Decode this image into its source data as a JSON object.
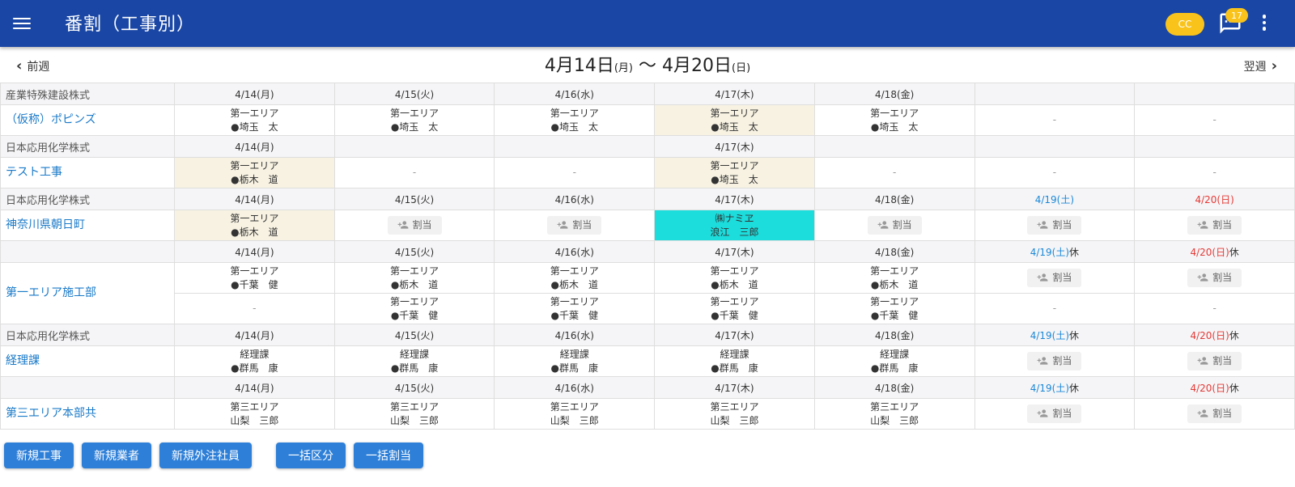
{
  "appbar": {
    "title": "番割（工事別）",
    "menu_icon": "menu-icon",
    "avatar_text": "CC",
    "chat_icon": "chat-icon",
    "notification_count": "17",
    "more_icon": "more-vert-icon"
  },
  "week_nav": {
    "prev_label": "前週",
    "next_label": "翌週",
    "start_date": "4月14日",
    "start_dow": "(月)",
    "separator": " 〜 ",
    "end_date": "4月20日",
    "end_dow": "(日)"
  },
  "labels": {
    "assign": "割当",
    "dash": "-"
  },
  "colors": {
    "appbar": "#1a47a5",
    "avatar": "#f9c31b",
    "highlight": "#f7f2e2",
    "cyan": "#1cdcdc",
    "saturday": "#1a88d8",
    "sunday": "#e53935",
    "action_button": "#2d7fd8"
  },
  "sections": [
    {
      "company": "産業特殊建設株式",
      "project": "（仮称）ポピンズ",
      "headers": [
        {
          "date": "4/14(月)",
          "kind": "weekday"
        },
        {
          "date": "4/15(火)",
          "kind": "weekday"
        },
        {
          "date": "4/16(水)",
          "kind": "weekday"
        },
        {
          "date": "4/17(木)",
          "kind": "weekday"
        },
        {
          "date": "4/18(金)",
          "kind": "weekday"
        },
        {
          "date": "",
          "kind": "weekday"
        },
        {
          "date": "",
          "kind": "weekday"
        }
      ],
      "rows": [
        [
          {
            "type": "text",
            "line1": "第一エリア",
            "line2": "●埼玉　太"
          },
          {
            "type": "text",
            "line1": "第一エリア",
            "line2": "●埼玉　太"
          },
          {
            "type": "text",
            "line1": "第一エリア",
            "line2": "●埼玉　太"
          },
          {
            "type": "text",
            "line1": "第一エリア",
            "line2": "●埼玉　太",
            "highlight": "hl"
          },
          {
            "type": "text",
            "line1": "第一エリア",
            "line2": "●埼玉　太"
          },
          {
            "type": "dash"
          },
          {
            "type": "dash"
          }
        ]
      ]
    },
    {
      "company": "日本応用化学株式",
      "project": "テスト工事",
      "headers": [
        {
          "date": "4/14(月)",
          "kind": "weekday"
        },
        {
          "date": "",
          "kind": "weekday"
        },
        {
          "date": "",
          "kind": "weekday"
        },
        {
          "date": "4/17(木)",
          "kind": "weekday"
        },
        {
          "date": "",
          "kind": "weekday"
        },
        {
          "date": "",
          "kind": "weekday"
        },
        {
          "date": "",
          "kind": "weekday"
        }
      ],
      "rows": [
        [
          {
            "type": "text",
            "line1": "第一エリア",
            "line2": "●栃木　道",
            "highlight": "hl"
          },
          {
            "type": "dash"
          },
          {
            "type": "dash"
          },
          {
            "type": "text",
            "line1": "第一エリア",
            "line2": "●埼玉　太",
            "highlight": "hl"
          },
          {
            "type": "dash"
          },
          {
            "type": "dash"
          },
          {
            "type": "dash"
          }
        ]
      ]
    },
    {
      "company": "日本応用化学株式",
      "project": "神奈川県朝日町",
      "headers": [
        {
          "date": "4/14(月)",
          "kind": "weekday"
        },
        {
          "date": "4/15(火)",
          "kind": "weekday"
        },
        {
          "date": "4/16(水)",
          "kind": "weekday"
        },
        {
          "date": "4/17(木)",
          "kind": "weekday"
        },
        {
          "date": "4/18(金)",
          "kind": "weekday"
        },
        {
          "date": "4/19(土)",
          "kind": "sat"
        },
        {
          "date": "4/20(日)",
          "kind": "sun"
        }
      ],
      "rows": [
        [
          {
            "type": "text",
            "line1": "第一エリア",
            "line2": "●栃木　道",
            "highlight": "hl"
          },
          {
            "type": "assign"
          },
          {
            "type": "assign"
          },
          {
            "type": "text",
            "line1": "㈱ナミヱ",
            "line2": "浪江　三郎",
            "highlight": "cyan"
          },
          {
            "type": "assign"
          },
          {
            "type": "assign"
          },
          {
            "type": "assign"
          }
        ]
      ]
    },
    {
      "company": "",
      "project": "第一エリア施工部",
      "headers": [
        {
          "date": "4/14(月)",
          "kind": "weekday"
        },
        {
          "date": "4/15(火)",
          "kind": "weekday"
        },
        {
          "date": "4/16(水)",
          "kind": "weekday"
        },
        {
          "date": "4/17(木)",
          "kind": "weekday"
        },
        {
          "date": "4/18(金)",
          "kind": "weekday"
        },
        {
          "date": "4/19(土)",
          "kind": "sat",
          "suffix": "休"
        },
        {
          "date": "4/20(日)",
          "kind": "sun",
          "suffix": "休"
        }
      ],
      "rows": [
        [
          {
            "type": "text",
            "line1": "第一エリア",
            "line2": "●千葉　健"
          },
          {
            "type": "text",
            "line1": "第一エリア",
            "line2": "●栃木　道"
          },
          {
            "type": "text",
            "line1": "第一エリア",
            "line2": "●栃木　道"
          },
          {
            "type": "text",
            "line1": "第一エリア",
            "line2": "●栃木　道"
          },
          {
            "type": "text",
            "line1": "第一エリア",
            "line2": "●栃木　道"
          },
          {
            "type": "assign"
          },
          {
            "type": "assign"
          }
        ],
        [
          {
            "type": "dash"
          },
          {
            "type": "text",
            "line1": "第一エリア",
            "line2": "●千葉　健"
          },
          {
            "type": "text",
            "line1": "第一エリア",
            "line2": "●千葉　健"
          },
          {
            "type": "text",
            "line1": "第一エリア",
            "line2": "●千葉　健"
          },
          {
            "type": "text",
            "line1": "第一エリア",
            "line2": "●千葉　健"
          },
          {
            "type": "dash"
          },
          {
            "type": "dash"
          }
        ]
      ]
    },
    {
      "company": "日本応用化学株式",
      "project": "経理課",
      "headers": [
        {
          "date": "4/14(月)",
          "kind": "weekday"
        },
        {
          "date": "4/15(火)",
          "kind": "weekday"
        },
        {
          "date": "4/16(水)",
          "kind": "weekday"
        },
        {
          "date": "4/17(木)",
          "kind": "weekday"
        },
        {
          "date": "4/18(金)",
          "kind": "weekday"
        },
        {
          "date": "4/19(土)",
          "kind": "sat",
          "suffix": "休"
        },
        {
          "date": "4/20(日)",
          "kind": "sun",
          "suffix": "休"
        }
      ],
      "rows": [
        [
          {
            "type": "text",
            "line1": "経理課",
            "line2": "●群馬　康"
          },
          {
            "type": "text",
            "line1": "経理課",
            "line2": "●群馬　康"
          },
          {
            "type": "text",
            "line1": "経理課",
            "line2": "●群馬　康"
          },
          {
            "type": "text",
            "line1": "経理課",
            "line2": "●群馬　康"
          },
          {
            "type": "text",
            "line1": "経理課",
            "line2": "●群馬　康"
          },
          {
            "type": "assign"
          },
          {
            "type": "assign"
          }
        ]
      ]
    },
    {
      "company": "",
      "project": "第三エリア本部共",
      "headers": [
        {
          "date": "4/14(月)",
          "kind": "weekday"
        },
        {
          "date": "4/15(火)",
          "kind": "weekday"
        },
        {
          "date": "4/16(水)",
          "kind": "weekday"
        },
        {
          "date": "4/17(木)",
          "kind": "weekday"
        },
        {
          "date": "4/18(金)",
          "kind": "weekday"
        },
        {
          "date": "4/19(土)",
          "kind": "sat",
          "suffix": "休"
        },
        {
          "date": "4/20(日)",
          "kind": "sun",
          "suffix": "休"
        }
      ],
      "rows": [
        [
          {
            "type": "text",
            "line1": "第三エリア",
            "line2": "山梨　三郎"
          },
          {
            "type": "text",
            "line1": "第三エリア",
            "line2": "山梨　三郎"
          },
          {
            "type": "text",
            "line1": "第三エリア",
            "line2": "山梨　三郎"
          },
          {
            "type": "text",
            "line1": "第三エリア",
            "line2": "山梨　三郎"
          },
          {
            "type": "text",
            "line1": "第三エリア",
            "line2": "山梨　三郎"
          },
          {
            "type": "assign"
          },
          {
            "type": "assign"
          }
        ]
      ]
    }
  ],
  "actions": {
    "new_project": "新規工事",
    "new_vendor": "新規業者",
    "new_outsourced_employee": "新規外注社員",
    "bulk_category": "一括区分",
    "bulk_assign": "一括割当"
  }
}
